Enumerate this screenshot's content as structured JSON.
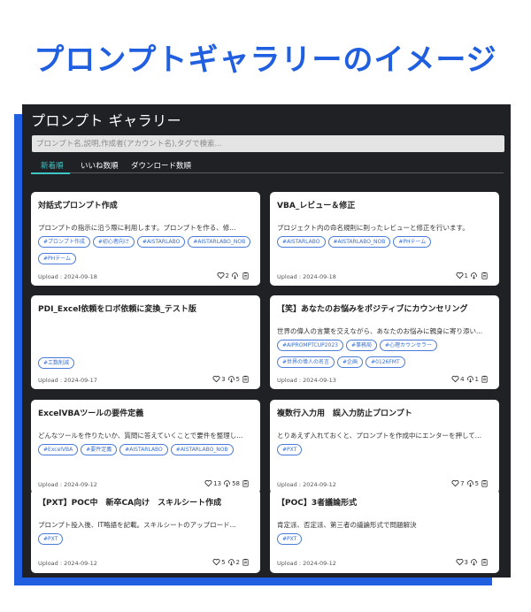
{
  "headline": "プロンプトギャラリーのイメージ",
  "app": {
    "title": "プロンプト ギャラリー",
    "search_placeholder": "プロンプト名,説明,作成者(アカウント名),タグで検索...",
    "tabs": [
      {
        "label": "新着順",
        "active": true
      },
      {
        "label": "いいね数順",
        "active": false
      },
      {
        "label": "ダウンロード数順",
        "active": false
      }
    ]
  },
  "colors": {
    "headline": "#1f5fe0",
    "panel_bg": "#202124",
    "accent_tab": "#3ec6c6",
    "tag_border": "#4a7bd8"
  },
  "icons": {
    "like": "heart-icon",
    "download": "cloud-download-icon",
    "copy": "clipboard-icon"
  },
  "cards": [
    {
      "title": "対話式プロンプト作成",
      "desc": "プロンプトの指示に沿う際に利用します。プロンプトを作る、修...",
      "tags": [
        "#プロンプト作成",
        "#初心者向け",
        "#AISTARLABO",
        "#AISTARLABO_NOB",
        "#PHテーム"
      ],
      "date": "Upload : 2024-09-18",
      "likes": "2",
      "downloads": ""
    },
    {
      "title": "VBA_レビュー＆修正",
      "desc": "プロジェクト内の命名規則に則ったレビューと修正を行います。",
      "tags": [
        "#AISTARLABO",
        "#AISTARLABO_NOB",
        "#PHテーム"
      ],
      "date": "Upload : 2024-09-18",
      "likes": "1",
      "downloads": ""
    },
    {
      "title": "PDI_Excel依頼をロボ依頼に変換_テスト版",
      "desc": "",
      "tags": [
        "#工数削減"
      ],
      "date": "Upload : 2024-09-17",
      "likes": "3",
      "downloads": "5"
    },
    {
      "title": "【笑】あなたのお悩みをポジティブにカウンセリング",
      "desc": "世界の偉人の言葉を交えながら、あなたのお悩みに親身に寄り添い...",
      "tags": [
        "#AIPROMPTCUP2023",
        "#事務局",
        "#心理カウンセラー",
        "#世界の偉人の名言",
        "#企画",
        "#0126FMT"
      ],
      "date": "Upload : 2024-09-13",
      "likes": "4",
      "downloads": "1"
    },
    {
      "title": "ExcelVBAツールの要件定義",
      "desc": "どんなツールを作りたいか、質問に答えていくことで要件を整理し...",
      "tags": [
        "#ExcelVBA",
        "#要件定義",
        "#AISTARLABO",
        "#AISTARLABO_NOB"
      ],
      "date": "Upload : 2024-09-12",
      "likes": "13",
      "downloads": "58"
    },
    {
      "title": "複数行入力用　誤入力防止プロンプト",
      "desc": "とりあえず入れておくと、プロンプトを作成中にエンターを押して...",
      "tags": [
        "#PXT"
      ],
      "date": "Upload : 2024-09-12",
      "likes": "7",
      "downloads": "5"
    },
    {
      "title": "【PXT】POC中　新卒CA向け　スキルシート作成",
      "desc": "プロンプト投入後、IT略語を記載。スキルシートのアップロード...",
      "tags": [
        "#PXT"
      ],
      "date": "Upload : 2024-09-12",
      "likes": "5",
      "downloads": "2"
    },
    {
      "title": "【POC】3者議論形式",
      "desc": "肯定派、否定派、第三者の議論形式で問題解決",
      "tags": [
        "#PXT"
      ],
      "date": "Upload : 2024-09-12",
      "likes": "3",
      "downloads": ""
    }
  ]
}
